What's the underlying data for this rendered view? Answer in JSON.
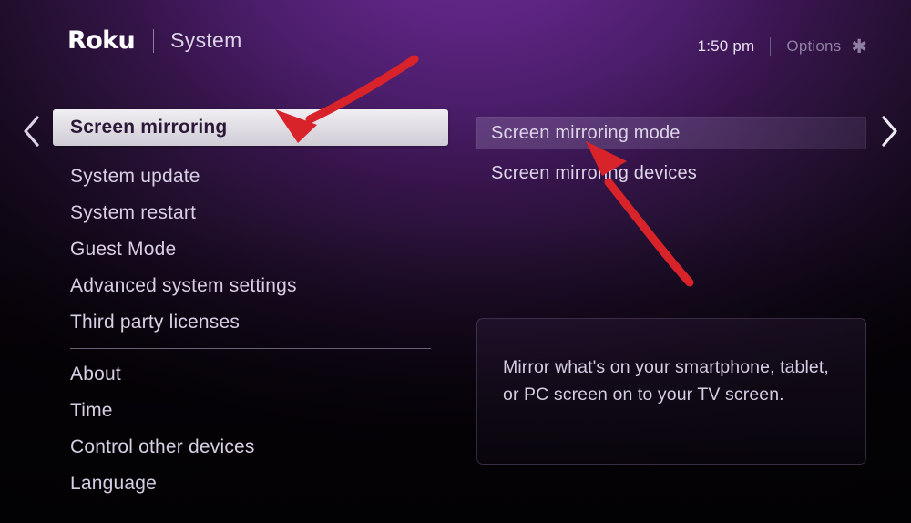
{
  "header": {
    "logo_text": "Roku",
    "section_title": "System",
    "clock": "1:50 pm",
    "options_label": "Options",
    "options_icon": "asterisk-icon"
  },
  "nav": {
    "left_chevron_icon": "chevron-left-icon",
    "right_chevron_icon": "chevron-right-icon"
  },
  "left_menu": {
    "items": [
      {
        "label": "Screen mirroring",
        "selected": true
      },
      {
        "label": "System update",
        "selected": false
      },
      {
        "label": "System restart",
        "selected": false
      },
      {
        "label": "Guest Mode",
        "selected": false
      },
      {
        "label": "Advanced system settings",
        "selected": false
      },
      {
        "label": "Third party licenses",
        "selected": false
      }
    ],
    "items_after_divider": [
      {
        "label": "About",
        "selected": false
      },
      {
        "label": "Time",
        "selected": false
      },
      {
        "label": "Control other devices",
        "selected": false
      },
      {
        "label": "Language",
        "selected": false
      }
    ]
  },
  "right_panel": {
    "items": [
      {
        "label": "Screen mirroring mode",
        "selected": true
      },
      {
        "label": "Screen mirroring devices",
        "selected": false
      }
    ],
    "description": "Mirror what's on your smartphone, tablet, or PC screen on to your TV screen."
  },
  "annotations": {
    "arrow_one": "red-arrow-pointing-to-screen-mirroring",
    "arrow_two": "red-arrow-pointing-to-screen-mirroring-mode"
  },
  "colors": {
    "background_purple": "#5c2480",
    "background_dark": "#0d0612",
    "selected_row_bg": "#e4e1e8",
    "selected_row_text": "#2b1738",
    "text_primary": "#d8cfe4",
    "text_muted": "#8f7fa3",
    "annotation_red": "#d8232a"
  }
}
